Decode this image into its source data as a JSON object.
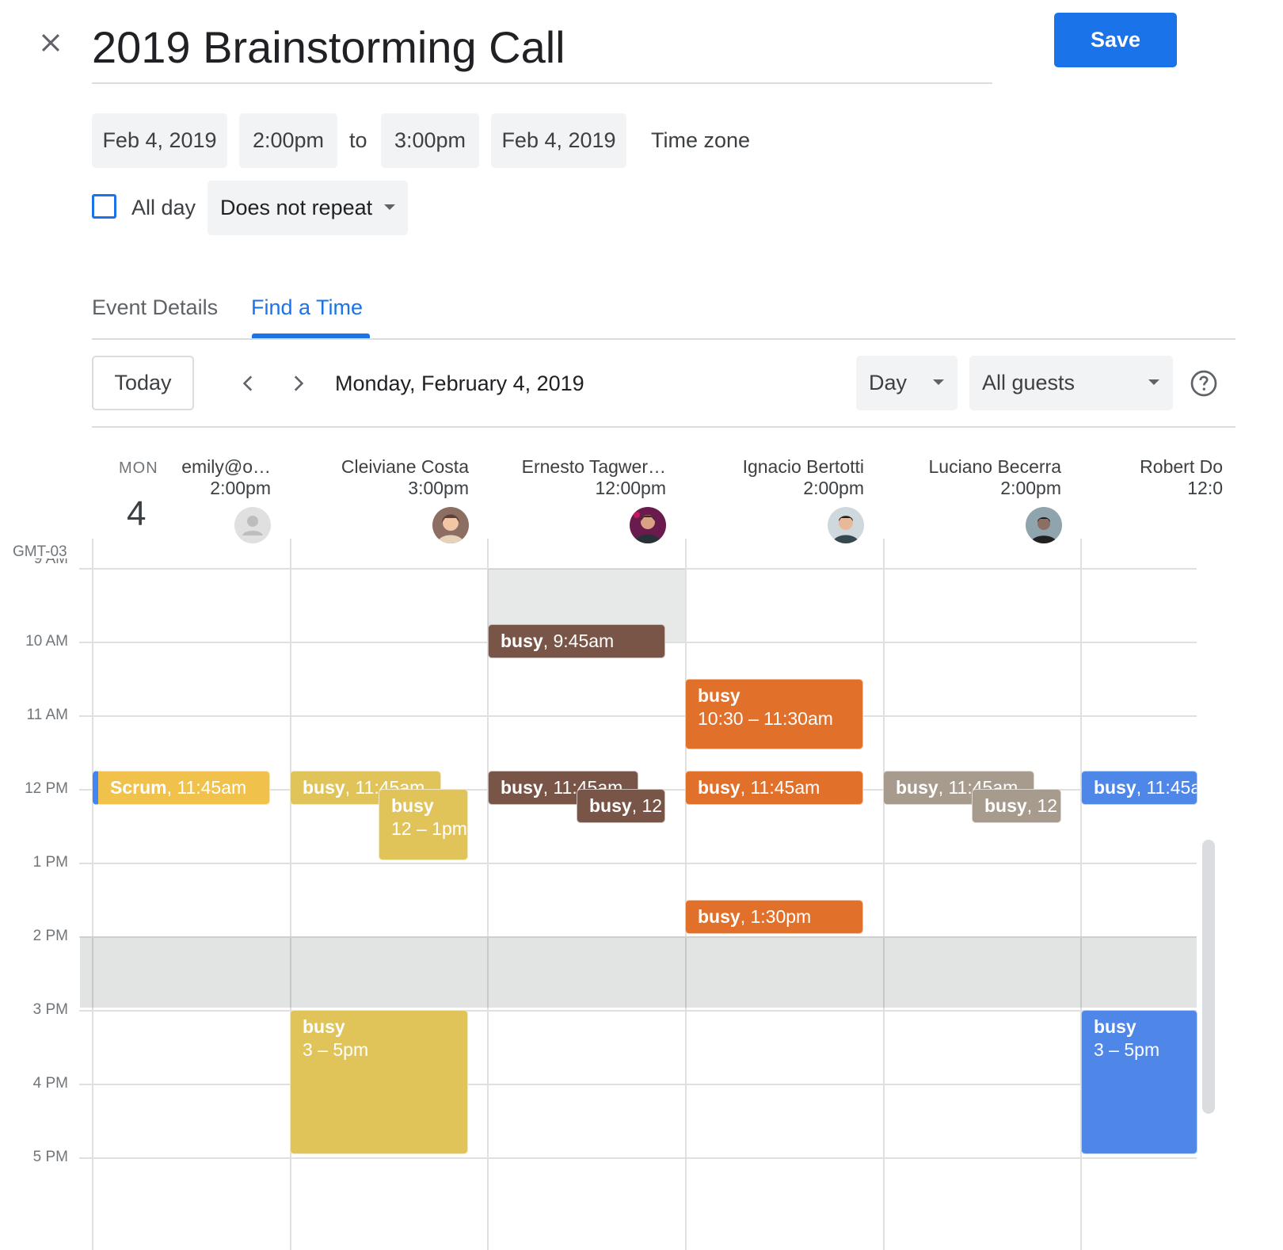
{
  "header": {
    "close_icon": "close-icon",
    "title": "2019 Brainstorming Call",
    "save_label": "Save",
    "accent_color": "#1a73e8"
  },
  "datetime": {
    "start_date": "Feb 4, 2019",
    "start_time": "2:00pm",
    "to_label": "to",
    "end_time": "3:00pm",
    "end_date": "Feb 4, 2019",
    "timezone_label": "Time zone",
    "all_day_label": "All day",
    "all_day_checked": false,
    "repeat": "Does not repeat"
  },
  "tabs": [
    {
      "label": "Event Details",
      "active": false
    },
    {
      "label": "Find a Time",
      "active": true
    }
  ],
  "toolbar": {
    "today_label": "Today",
    "date_label": "Monday, February 4, 2019",
    "view": "Day",
    "guests_filter": "All guests",
    "help_icon": "help-icon"
  },
  "day_header": {
    "day_name": "MON",
    "day_number": "4",
    "timezone": "GMT-03"
  },
  "people": [
    {
      "name": "emily@o…",
      "time": "2:00pm"
    },
    {
      "name": "Cleiviane Costa",
      "time": "3:00pm"
    },
    {
      "name": "Ernesto Tagwer…",
      "time": "12:00pm"
    },
    {
      "name": "Ignacio Bertotti",
      "time": "2:00pm"
    },
    {
      "name": "Luciano Becerra",
      "time": "2:00pm"
    },
    {
      "name": "Robert Do",
      "time": "12:0"
    }
  ],
  "hours": [
    "9 AM",
    "10 AM",
    "11 AM",
    "12 PM",
    "1 PM",
    "2 PM",
    "3 PM",
    "4 PM",
    "5 PM"
  ],
  "events": [
    {
      "col": 0,
      "title": "Scrum",
      "time": ", 11:45am",
      "color": "#f0c14b"
    },
    {
      "col": 1,
      "title": "busy",
      "time": ", 11:45am",
      "color": "#e0c45a"
    },
    {
      "col": 1,
      "title": "busy",
      "time": "12 – 1pm",
      "color": "#e0c45a"
    },
    {
      "col": 1,
      "title": "busy",
      "time": "3 – 5pm",
      "color": "#e0c45a"
    },
    {
      "col": 2,
      "title": "busy",
      "time": ", 9:45am",
      "color": "#795548"
    },
    {
      "col": 2,
      "title": "busy",
      "time": ", 11:45am",
      "color": "#795548"
    },
    {
      "col": 2,
      "title": "busy",
      "time": ", 12",
      "color": "#795548"
    },
    {
      "col": 3,
      "title": "busy",
      "time": "10:30 – 11:30am",
      "color": "#e0702a"
    },
    {
      "col": 3,
      "title": "busy",
      "time": ", 11:45am",
      "color": "#e0702a"
    },
    {
      "col": 3,
      "title": "busy",
      "time": ", 1:30pm",
      "color": "#e0702a"
    },
    {
      "col": 4,
      "title": "busy",
      "time": ", 11:45am",
      "color": "#a79b8e"
    },
    {
      "col": 4,
      "title": "busy",
      "time": ", 12",
      "color": "#a79b8e"
    },
    {
      "col": 5,
      "title": "busy",
      "time": ", 11:45a",
      "color": "#4f87e8"
    },
    {
      "col": 5,
      "title": "busy",
      "time": "3 – 5pm",
      "color": "#4f87e8"
    }
  ]
}
